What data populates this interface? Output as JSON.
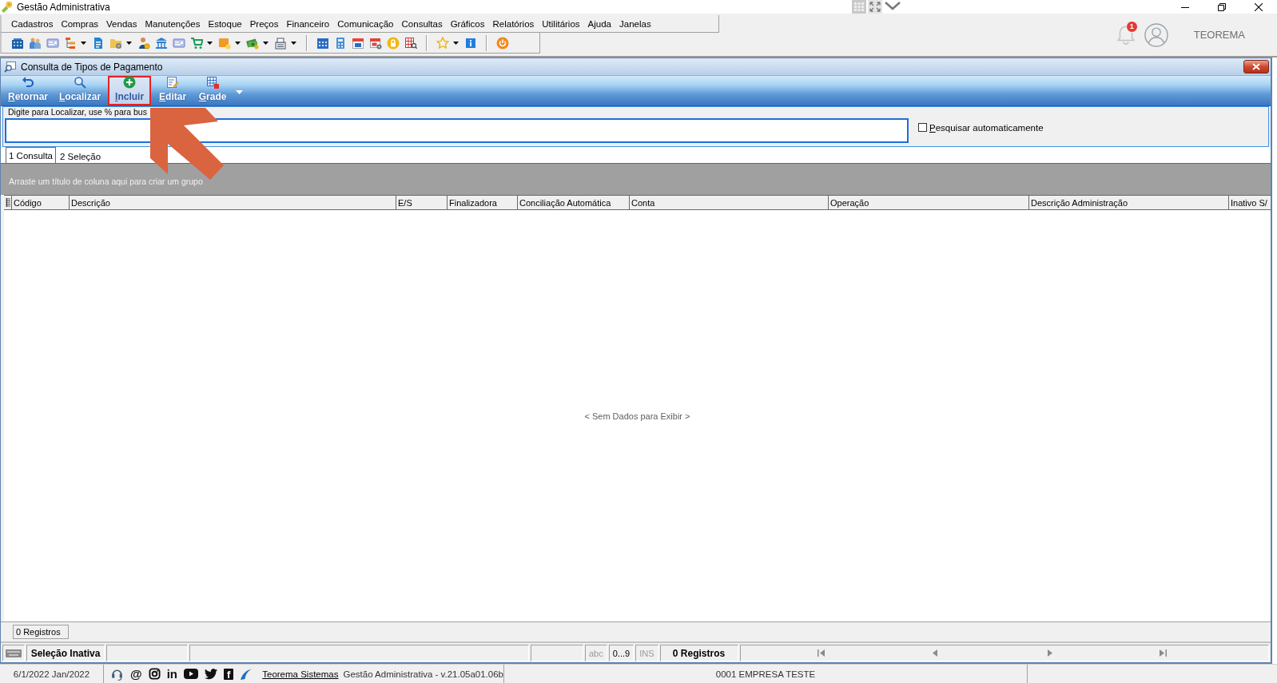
{
  "app_window": {
    "title": "Gestão Administrativa"
  },
  "menu": [
    "Cadastros",
    "Compras",
    "Vendas",
    "Manutenções",
    "Estoque",
    "Preços",
    "Financeiro",
    "Comunicação",
    "Consultas",
    "Gráficos",
    "Relatórios",
    "Utilitários",
    "Ajuda",
    "Janelas"
  ],
  "account": {
    "notifications": "1",
    "user": "TEOREMA"
  },
  "child_window": {
    "title": "Consulta de Tipos de Pagamento"
  },
  "ribbon": [
    {
      "label": "Retornar",
      "kind": "return",
      "highlighted": false,
      "outlined": false,
      "dropdown": false
    },
    {
      "label": "Localizar",
      "kind": "search",
      "highlighted": false,
      "outlined": false,
      "dropdown": false
    },
    {
      "label": "Incluir",
      "kind": "add",
      "highlighted": true,
      "outlined": true,
      "dropdown": false
    },
    {
      "label": "Editar",
      "kind": "edit",
      "highlighted": false,
      "outlined": false,
      "dropdown": false
    },
    {
      "label": "Grade",
      "kind": "grid",
      "highlighted": false,
      "outlined": false,
      "dropdown": true
    }
  ],
  "search": {
    "legend": "Digite para Localizar, use % para bus",
    "auto_search": {
      "label": "Pesquisar automaticamente",
      "checked": false
    }
  },
  "tabs": [
    {
      "label": "1 Consulta",
      "selected": true
    },
    {
      "label": "2 Seleção",
      "selected": false
    }
  ],
  "group_panel": {
    "hint": "Arraste um título de coluna aqui para criar um grupo"
  },
  "table": {
    "columns": [
      "Código",
      "Descrição",
      "E/S",
      "Finalizadora",
      "Conciliação Automática",
      "Conta",
      "Operação",
      "Descrição Administração",
      "Inativo S/"
    ],
    "empty_text": "< Sem Dados para Exibir >",
    "footer": "0 Registros"
  },
  "status_bar": {
    "selection": "Seleção Inativa",
    "indicators": [
      {
        "label": "abc",
        "on": false
      },
      {
        "label": "0...9",
        "on": true
      },
      {
        "label": "INS",
        "on": false
      }
    ],
    "records": "0 Registros",
    "navigation": [
      {
        "kind": "first",
        "disabled": true
      },
      {
        "kind": "previous",
        "disabled": true
      },
      {
        "kind": "next",
        "disabled": true
      },
      {
        "kind": "last",
        "disabled": true
      }
    ]
  },
  "bottom_bar": {
    "date": "6/1/2022 Jan/2022",
    "social": [
      {
        "kind": "headset"
      },
      {
        "kind": "glyph",
        "text": "@"
      },
      {
        "kind": "camera"
      },
      {
        "kind": "glyph",
        "text": "in"
      },
      {
        "kind": "play"
      },
      {
        "kind": "bird"
      },
      {
        "kind": "boxed-glyph",
        "text": "f"
      },
      {
        "kind": "swoosh"
      }
    ],
    "link": "Teorema Sistemas",
    "version": "Gestão Administrativa - v.21.05a01.06b",
    "company": "0001 EMPRESA TESTE"
  }
}
